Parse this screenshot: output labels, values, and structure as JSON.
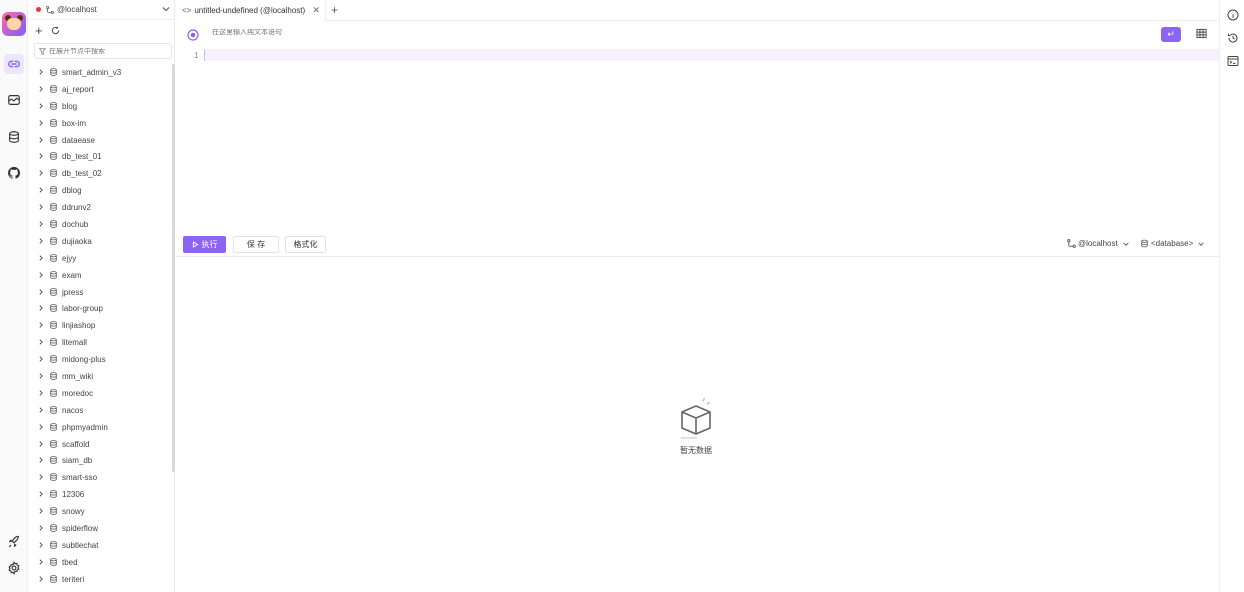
{
  "connection": {
    "name": "@localhost"
  },
  "sidebar": {
    "filter_placeholder": "在展开节点中搜索",
    "databases": [
      "smart_admin_v3",
      "aj_report",
      "blog",
      "box-im",
      "dataease",
      "db_test_01",
      "db_test_02",
      "dblog",
      "ddrunv2",
      "dochub",
      "dujiaoka",
      "ejyy",
      "exam",
      "jpress",
      "labor-group",
      "linjiashop",
      "litemall",
      "midong-plus",
      "mm_wiki",
      "moredoc",
      "nacos",
      "phpmyadmin",
      "scaffold",
      "siam_db",
      "smart-sso",
      "12306",
      "snowy",
      "spiderflow",
      "subtlechat",
      "tbed",
      "teriteri"
    ]
  },
  "tab": {
    "label": "untitled-undefined (@localhost)"
  },
  "editor": {
    "nl_placeholder": "在这里输入纯文本语句",
    "line_number": "1"
  },
  "actions": {
    "run_label": "执行",
    "save_label": "保 存",
    "format_label": "格式化",
    "connection_label": "@localhost",
    "database_label": "<database>"
  },
  "results": {
    "empty_text": "暂无数据"
  },
  "colors": {
    "accent": "#8b63f5",
    "status_dot": "#e53935"
  },
  "icons": {
    "rail": [
      "link-icon",
      "dashboard-icon",
      "database-icon",
      "github-icon",
      "rocket-icon",
      "gear-icon"
    ],
    "right_rail": [
      "info-icon",
      "history-icon",
      "terminal-icon"
    ]
  }
}
